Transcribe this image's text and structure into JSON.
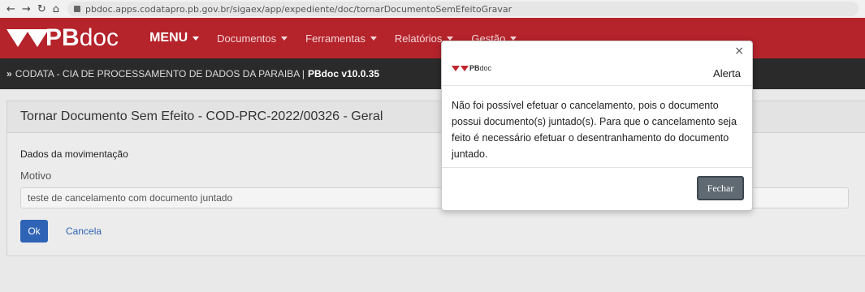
{
  "browser": {
    "url": "pbdoc.apps.codatapro.pb.gov.br/sigaex/app/expediente/doc/tornarDocumentoSemEfeitoGravar"
  },
  "nav": {
    "logo_bold": "PB",
    "logo_light": "doc",
    "menu": "MENU",
    "items": [
      "Documentos",
      "Ferramentas",
      "Relatórios",
      "Gestão"
    ]
  },
  "crumb": {
    "text": "CODATA - CIA DE PROCESSAMENTO DE DADOS DA PARAIBA |",
    "version": "PBdoc v10.0.35"
  },
  "page": {
    "title": "Tornar Documento Sem Efeito - COD-PRC-2022/00326 - Geral",
    "section": "Dados da movimentação",
    "field_label": "Motivo",
    "field_value": "teste de cancelamento com documento juntado",
    "ok": "Ok",
    "cancel": "Cancela"
  },
  "modal": {
    "logo_bold": "PB",
    "logo_light": "doc",
    "title": "Alerta",
    "close_symbol": "×",
    "message": "Não foi possível efetuar o cancelamento, pois o documento possui documento(s) juntado(s). Para que o cancelamento seja feito é necessário efetuar o desentranhamento do documento juntado.",
    "button": "Fechar"
  },
  "colors": {
    "brand_red": "#b5232b",
    "primary_blue": "#2f63b5",
    "dark_bar": "#2a2a2a"
  }
}
